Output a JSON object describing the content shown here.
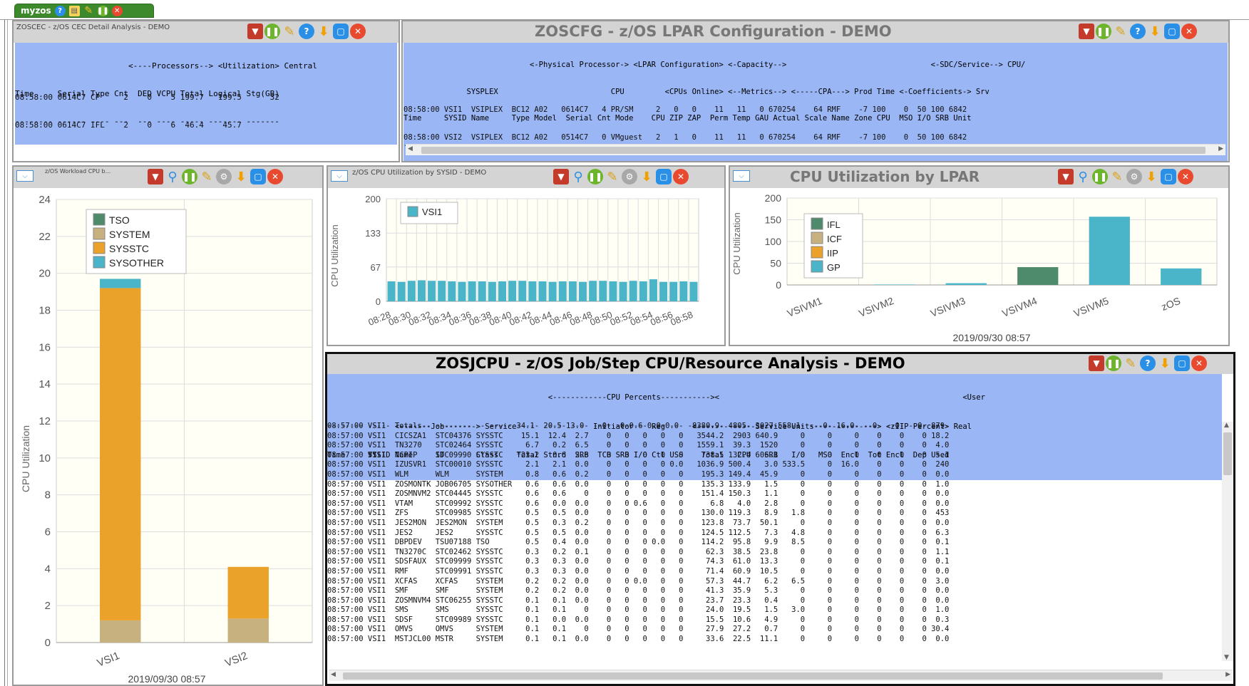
{
  "tab": {
    "label": "myzos"
  },
  "cec": {
    "title": "ZOSCEC - z/OS CEC Detail Analysis - DEMO",
    "header": [
      "                        <----Processors--> <Utilization> Central",
      "Time     Serial Type Cnt  DED VCPU Total Logical Stg(GB)",
      "-------- ------ ---- ---  --- ---- ----- ------- -------"
    ],
    "rows": [
      "08:58:00 0614C7 CP     2    0    5 199.7   199.5      32",
      "08:58:00 0614C7 IFL    2    0    6  46.4    45.7"
    ]
  },
  "lpar": {
    "title": "ZOSCFG - z/OS LPAR Configuration - DEMO",
    "header": [
      "                            <-Physical Processor-> <LPAR Configuration> <-Capacity-->                                <-SDC/Service--> CPU/",
      "              SYSPLEX                         CPU         <CPUs Online> <--Metrics--> <-----CPA---> Prod Time <-Coefficients-> Srv",
      "Time     SYSID Name     Type Model  Serial Cnt Mode    CPU ZIP ZAP  Perm Temp GAU Actual Scale Name Zone CPU  MSO I/O SRB Unit",
      "-------- ----- -------- ---- ----- ------ --- ------- --- --- ---  ---- ---- --- ------ ----- ---- ---- ---  --- --- --- ----"
    ],
    "rows": [
      "08:58:00 VSI1  VSIPLEX  BC12 A02   0614C7   4 PR/SM     2   0   0    11   11   0 670254    64 RMF    -7 100    0  50 100 6842",
      "08:58:00 VSI2  VSIPLEX  BC12 A02   0514C7   0 VMguest   2   1   0    11   11   0 670254    64 RMF    -7 100    0  50 100 6842"
    ]
  },
  "workload": {
    "title": "z/OS Workload CPU b...",
    "ylabel": "CPU Utilization",
    "date": "2019/09/30 08:57"
  },
  "sysid": {
    "title": "z/OS CPU Utilization by SYSID - DEMO",
    "ylabel": "CPU Utilization"
  },
  "lparchart": {
    "title": "CPU Utilization by LPAR",
    "ylabel": "CPU Utilization",
    "date": "2019/09/30 08:57"
  },
  "jobs": {
    "title": "ZOSJCPU - z/OS Job/Step CPU/Resource Analysis - DEMO",
    "header": [
      "                                                 <------------CPU Percents-----------><                                                      <User",
      "               <-------Job-------> Service                 Initiator    Reg      <-------------Service Units--------------> <zIIP Percent> Real",
      "Time     SYSID Name     ID       Class    Total Stnrd  SRB  TCB SRB I/O Ctl USS    Total   CPU   SRB   I/O   MSO  Encl  Tot Encl  Dep Used",
      "-------- ----- -------- -------- -------- ----- ----- ---- ---- --- --- --- --- -------- ----- ----- ----- ----- ----- ---- ---- ---- ----",
      "         *1--                             *2--"
    ],
    "rows": [
      "08:57:00 VSI1  Totals                     34.1  20.5 13.0    0   0 0.6 0.0 0.0   8380.9  4805  3027 558.1     0  16.0    0    0    0  879",
      "08:57:00 VSI1  CICSZA1  STC04376 SYSSTC    15.1  12.4  2.7    0   0   0   0   0   3544.2  2903 640.9     0     0     0    0    0    0 18.2",
      "08:57:00 VSI1  TN3270   STC02464 SYSSTC     6.7   0.2  6.5    0   0   0   0   0   1559.1  39.3  1520     0     0     0    0    0    0  4.0",
      "08:57:00 VSI1  TCPIP    STC09990 SYSSTC     3.2   0.6  2.6    0   0   0   0   0    738.5 132.4 606.1     0     0     0    0    0    0  5.1",
      "08:57:00 VSI1  IZUSVR1  STC00010 SYSSTC     2.1   2.1  0.0    0   0   0   0 0.0   1036.9 500.4   3.0 533.5     0  16.0    0    0    0  240",
      "08:57:00 VSI1  WLM      WLM      SYSTEM     0.8   0.6  0.2    0   0   0   0   0    195.3 149.4  45.9     0     0     0    0    0    0  0.0",
      "08:57:00 VSI1  ZOSMONTK JOB06705 SYSOTHER   0.6   0.6  0.0    0   0   0   0   0    135.3 133.9   1.5     0     0     0    0    0    0  1.0",
      "08:57:00 VSI1  ZOSMNVM2 STC04445 SYSSTC     0.6   0.6    0    0   0   0   0   0    151.4 150.3   1.1     0     0     0    0    0    0  0.0",
      "08:57:00 VSI1  VTAM     STC09992 SYSSTC     0.6   0.0  0.0    0   0 0.6   0   0      6.8   4.0   2.8     0     0     0    0    0    0  0.0",
      "08:57:00 VSI1  ZFS      STC09985 SYSSTC     0.5   0.5  0.0    0   0   0   0   0    130.0 119.3   8.9   1.8     0     0    0    0    0  453",
      "08:57:00 VSI1  JES2MON  JES2MON  SYSTEM     0.5   0.3  0.2    0   0   0   0   0    123.8  73.7  50.1     0     0     0    0    0    0  0.0",
      "08:57:00 VSI1  JES2     JES2     SYSSTC     0.5   0.5  0.0    0   0   0   0   0    124.5 112.5   7.3   4.8     0     0    0    0    0  6.3",
      "08:57:00 VSI1  DBPDEV   TSU07188 TSO        0.5   0.4  0.0    0   0   0 0.0   0    114.2  95.8   9.9   8.5     0     0    0    0    0  0.1",
      "08:57:00 VSI1  TN3270C  STC02462 SYSSTC     0.3   0.2  0.1    0   0   0   0   0     62.3  38.5  23.8     0     0     0    0    0    0  1.1",
      "08:57:00 VSI1  SDSFAUX  STC09999 SYSSTC     0.3   0.3  0.0    0   0   0   0   0     74.3  61.0  13.3     0     0     0    0    0    0  0.1",
      "08:57:00 VSI1  RMF      STC09991 SYSSTC     0.3   0.3  0.0    0   0   0   0   0     71.4  60.9  10.5     0     0     0    0    0    0  0.0",
      "08:57:00 VSI1  XCFAS    XCFAS    SYSTEM     0.2   0.2  0.0    0   0 0.0   0   0     57.3  44.7   6.2   6.5     0     0    0    0    0  3.0",
      "08:57:00 VSI1  SMF      SMF      SYSTEM     0.2   0.2  0.0    0   0   0   0   0     41.3  35.9   5.3     0     0     0    0    0    0  0.0",
      "08:57:00 VSI1  ZOSMNVM4 STC06255 SYSSTC     0.1   0.1  0.0    0   0   0   0   0     23.7  23.3   0.4     0     0     0    0    0    0  0.0",
      "08:57:00 VSI1  SMS      SMS      SYSSTC     0.1   0.1    0    0   0   0   0   0     24.0  19.5   1.5   3.0     0     0    0    0    0  1.0",
      "08:57:00 VSI1  SDSF     STC09989 SYSSTC     0.1   0.0  0.0    0   0   0   0   0     15.5  10.6   4.9     0     0     0    0    0    0  0.3",
      "08:57:00 VSI1  OMVS     OMVS     SYSTEM     0.1   0.1    0    0   0   0   0   0     27.9  27.2   0.7     0     0     0    0    0    0 30.4",
      "08:57:00 VSI1  MSTJCL00 MSTR     SYSTEM     0.1   0.1  0.0    0   0   0   0   0     33.6  22.5  11.1     0     0     0    0    0    0  0.0"
    ]
  },
  "chart_data": [
    {
      "type": "bar",
      "stacked": true,
      "categories": [
        "VSI1",
        "VSI2"
      ],
      "series": [
        {
          "name": "TSO",
          "color": "#4e8b6c",
          "values": [
            0,
            0
          ]
        },
        {
          "name": "SYSTEM",
          "color": "#c7b27f",
          "values": [
            1.2,
            1.3
          ]
        },
        {
          "name": "SYSSTC",
          "color": "#eaa22a",
          "values": [
            18.0,
            2.8
          ]
        },
        {
          "name": "SYSOTHER",
          "color": "#4ab5c8",
          "values": [
            0.5,
            0
          ]
        }
      ],
      "ylabel": "CPU Utilization",
      "ylim": [
        0,
        24
      ],
      "yticks": [
        0,
        2,
        4,
        6,
        8,
        10,
        12,
        14,
        16,
        18,
        20,
        22,
        24
      ],
      "legend": "top-left",
      "xlabel": "2019/09/30 08:57"
    },
    {
      "type": "bar",
      "categories": [
        "08:28",
        "08:29",
        "08:30",
        "08:31",
        "08:32",
        "08:33",
        "08:34",
        "08:35",
        "08:36",
        "08:37",
        "08:38",
        "08:39",
        "08:40",
        "08:41",
        "08:42",
        "08:43",
        "08:44",
        "08:45",
        "08:46",
        "08:47",
        "08:48",
        "08:49",
        "08:50",
        "08:51",
        "08:52",
        "08:53",
        "08:54",
        "08:55",
        "08:56",
        "08:57",
        "08:58"
      ],
      "tick_labels": [
        "08:28",
        "08:30",
        "08:32",
        "08:34",
        "08:36",
        "08:38",
        "08:40",
        "08:42",
        "08:44",
        "08:46",
        "08:48",
        "08:50",
        "08:52",
        "08:54",
        "08:56",
        "08:58"
      ],
      "series": [
        {
          "name": "VSI1",
          "color": "#4ab5c8",
          "values": [
            39,
            38,
            40,
            41,
            40,
            40,
            39,
            38,
            39,
            39,
            38,
            39,
            40,
            40,
            39,
            39,
            38,
            39,
            39,
            38,
            40,
            40,
            39,
            38,
            40,
            39,
            43,
            38,
            38,
            39,
            38
          ]
        }
      ],
      "ylabel": "CPU Utilization",
      "ylim": [
        0,
        200
      ],
      "yticks": [
        0,
        67,
        133,
        200
      ],
      "legend": "top-left"
    },
    {
      "type": "bar",
      "stacked": true,
      "categories": [
        "VSIVM1",
        "VSIVM2",
        "VSIVM3",
        "VSIVM4",
        "VSIVM5",
        "zOS"
      ],
      "series": [
        {
          "name": "IFL",
          "color": "#4e8b6c",
          "values": [
            0,
            0,
            0,
            41,
            0,
            0
          ]
        },
        {
          "name": "ICF",
          "color": "#c7b27f",
          "values": [
            0,
            0,
            0,
            0,
            0,
            0
          ]
        },
        {
          "name": "IIP",
          "color": "#eaa22a",
          "values": [
            0,
            0,
            0,
            0,
            0,
            0
          ]
        },
        {
          "name": "GP",
          "color": "#4ab5c8",
          "values": [
            0,
            1,
            4,
            0,
            157,
            38
          ]
        }
      ],
      "title": "CPU Utilization by LPAR",
      "ylabel": "CPU Utilization",
      "ylim": [
        0,
        200
      ],
      "yticks": [
        0,
        50,
        100,
        150,
        200
      ],
      "legend": "top-left",
      "xlabel": "2019/09/30 08:57"
    }
  ]
}
